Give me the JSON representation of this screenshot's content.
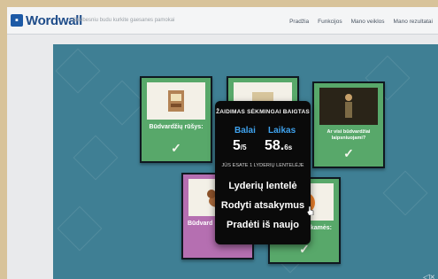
{
  "header": {
    "logo": "Wordwall",
    "activity_title": "Griebesniu budu kurkite gaesanes pamokai",
    "nav": [
      "Pradžia",
      "Funkcijos",
      "Mano veiklos",
      "Mano rezultatai"
    ]
  },
  "cards": [
    {
      "label": "Būdvardžių rūšys:",
      "check": "✓",
      "image": "book-icon"
    },
    {
      "label": "Ar visi būdvardžiai laipsniuojami?",
      "check": "✓",
      "image": "figure-icon"
    },
    {
      "label": "Būdvard",
      "check": "",
      "image": "dog-icon"
    },
    {
      "label": "elkamės:",
      "check": "✓",
      "image": "orange-icon"
    }
  ],
  "popup": {
    "title": "ŽAIDIMAS SĖKMINGAI BAIGTAS",
    "score_label": "Balai",
    "score": "5",
    "score_total": "/5",
    "time_label": "Laikas",
    "time": "58.",
    "time_fraction": "6s",
    "rank": "JŪS ESATE 1 LYDERIŲ LENTELĖJE",
    "buttons": [
      "Lyderių lentelė",
      "Rodyti atsakymus",
      "Pradėti iš naujo"
    ]
  },
  "colors": {
    "canvas": "#3f7f94",
    "card": "#58a86a",
    "popup": "#0a0a0a",
    "accent": "#3fa3ef"
  }
}
